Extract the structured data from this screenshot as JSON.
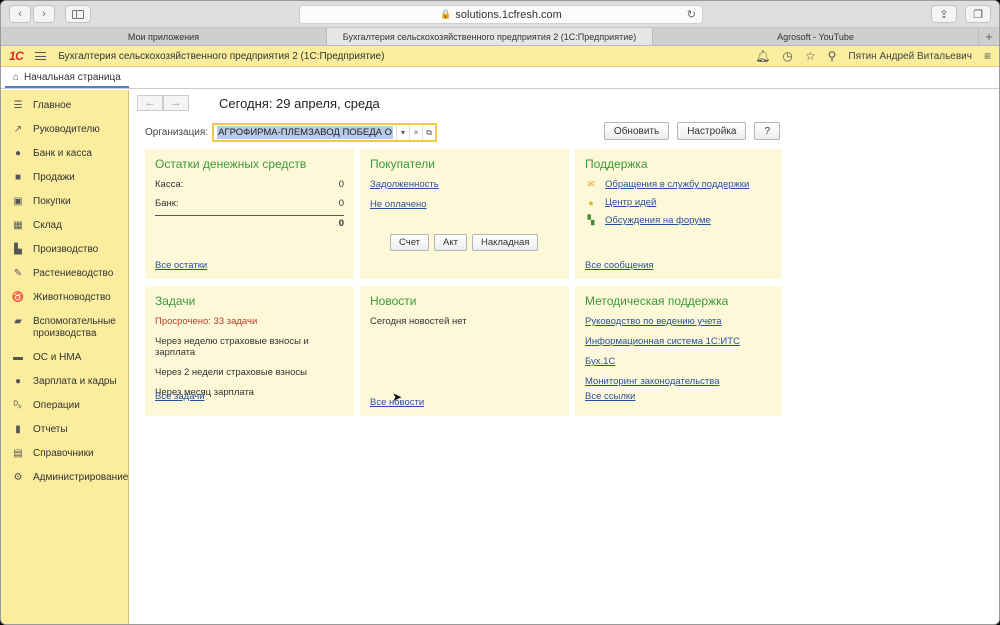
{
  "browser": {
    "url": "solutions.1cfresh.com",
    "tabs": [
      {
        "label": "Мои приложения"
      },
      {
        "label": "Бухгалтерия сельскохозяйственного предприятия 2 (1С:Предприятие)"
      },
      {
        "label": "Agrosoft - YouTube"
      }
    ]
  },
  "app": {
    "logo": "1С",
    "title": "Бухгалтерия сельскохозяйственного предприятия 2  (1С:Предприятие)",
    "user": "Пятин Андрей Витальевич",
    "home_tab": "Начальная страница"
  },
  "sidebar": {
    "items": [
      {
        "label": "Главное",
        "icon": "list-icon",
        "glyph": "☰"
      },
      {
        "label": "Руководителю",
        "icon": "trend-icon",
        "glyph": "↗"
      },
      {
        "label": "Банк и касса",
        "icon": "coin-icon",
        "glyph": "●"
      },
      {
        "label": "Продажи",
        "icon": "bag-icon",
        "glyph": "■"
      },
      {
        "label": "Покупки",
        "icon": "cart-icon",
        "glyph": "▣"
      },
      {
        "label": "Склад",
        "icon": "warehouse-icon",
        "glyph": "▦"
      },
      {
        "label": "Производство",
        "icon": "factory-icon",
        "glyph": "▙"
      },
      {
        "label": "Растениеводство",
        "icon": "plant-icon",
        "glyph": "✎"
      },
      {
        "label": "Животноводство",
        "icon": "cow-icon",
        "glyph": "♉"
      },
      {
        "label": "Вспомогательные производства",
        "icon": "tractor-icon",
        "glyph": "▰"
      },
      {
        "label": "ОС и НМА",
        "icon": "truck-icon",
        "glyph": "▬"
      },
      {
        "label": "Зарплата и кадры",
        "icon": "person-icon",
        "glyph": "●"
      },
      {
        "label": "Операции",
        "icon": "operations-icon",
        "glyph": "ᴰₖ"
      },
      {
        "label": "Отчеты",
        "icon": "chart-icon",
        "glyph": "▮"
      },
      {
        "label": "Справочники",
        "icon": "book-icon",
        "glyph": "▤"
      },
      {
        "label": "Администрирование",
        "icon": "gear-icon",
        "glyph": "⚙"
      }
    ]
  },
  "page": {
    "today": "Сегодня: 29 апреля, среда",
    "org_label": "Организация:",
    "org_value": "АГРОФИРМА-ПЛЕМЗАВОД ПОБЕДА О",
    "refresh": "Обновить",
    "settings": "Настройка",
    "help": "?"
  },
  "panels": {
    "cash": {
      "title": "Остатки денежных средств",
      "kassa_label": "Касса:",
      "kassa_value": "0",
      "bank_label": "Банк:",
      "bank_value": "0",
      "total": "0",
      "link": "Все остатки"
    },
    "buyers": {
      "title": "Покупатели",
      "link1": "Задолженность",
      "link2": "Не оплачено",
      "btn1": "Счет",
      "btn2": "Акт",
      "btn3": "Накладная"
    },
    "support": {
      "title": "Поддержка",
      "link1": "Обращения в службу поддержки",
      "link2": "Центр идей",
      "link3": "Обсуждения на форуме",
      "link_all": "Все сообщения"
    },
    "tasks": {
      "title": "Задачи",
      "overdue": "Просрочено: 33 задачи",
      "t1": "Через неделю страховые взносы и зарплата",
      "t2": "Через 2 недели страховые взносы",
      "t3": "Через месяц зарплата",
      "link": "Все задачи"
    },
    "news": {
      "title": "Новости",
      "text": "Сегодня новостей нет",
      "link": "Все новости"
    },
    "methodic": {
      "title": "Методическая поддержка",
      "link1": "Руководство по ведению учета",
      "link2": "Информационная система 1С:ИТС",
      "link3": "Бух.1С",
      "link4": "Мониторинг законодательства",
      "link_all": "Все ссылки"
    }
  }
}
